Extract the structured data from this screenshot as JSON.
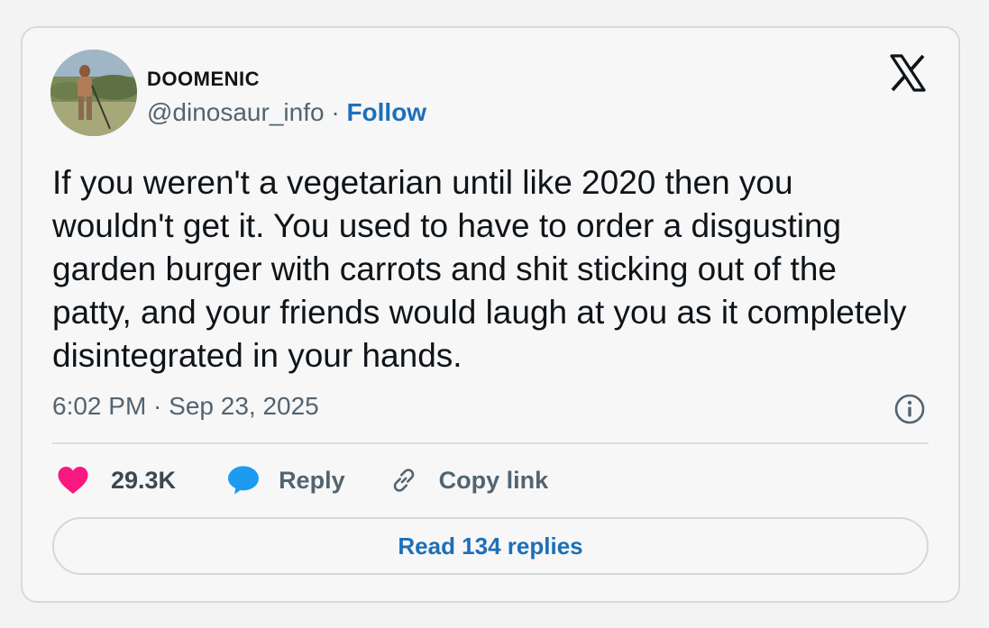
{
  "tweet": {
    "display_name": "DOOMENIC",
    "handle": "@dinosaur_info",
    "separator": " · ",
    "follow_label": "Follow",
    "text": "If you weren't a vegetarian until like 2020 then you wouldn't get it. You used to have to order a disgusting garden burger with carrots and shit sticking out of the patty, and your friends would laugh at you as it completely disintegrated in your hands.",
    "timestamp": "6:02 PM · Sep 23, 2025"
  },
  "actions": {
    "like_count": "29.3K",
    "reply_label": "Reply",
    "copy_link_label": "Copy link",
    "read_replies_label": "Read 134 replies"
  },
  "icons": {
    "brand": "x-logo-icon",
    "like": "heart-icon",
    "reply": "speech-bubble-icon",
    "copy": "link-icon",
    "info": "info-icon"
  },
  "colors": {
    "like": "#f91880",
    "reply": "#1d9bf0",
    "link_blue": "#1d6fb8",
    "secondary_text": "#536471",
    "primary_text": "#0f1419"
  }
}
